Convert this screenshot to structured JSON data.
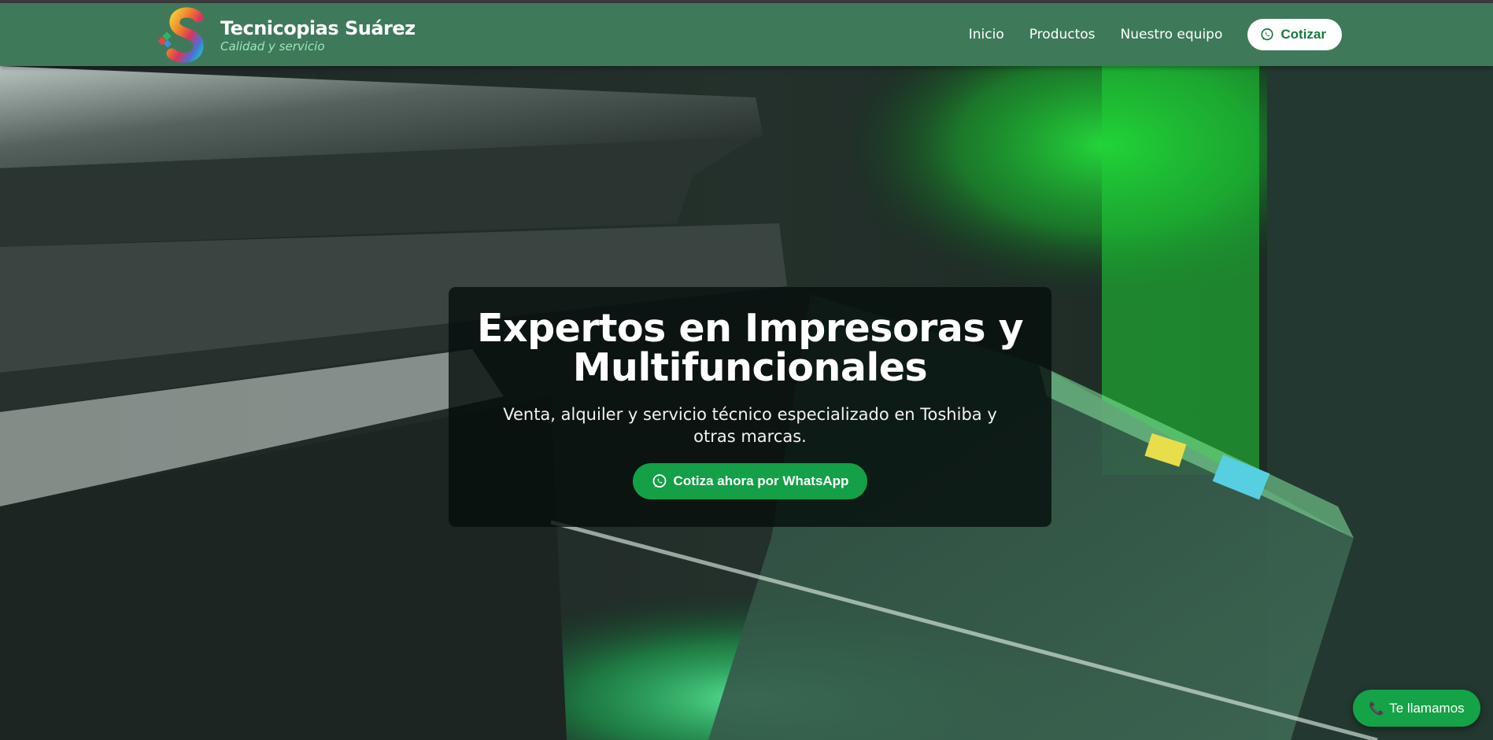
{
  "brand": {
    "name": "Tecnicopias Suárez",
    "tagline": "Calidad y servicio"
  },
  "nav": {
    "items": [
      {
        "label": "Inicio"
      },
      {
        "label": "Productos"
      },
      {
        "label": "Nuestro equipo"
      }
    ],
    "cta_label": "Cotizar"
  },
  "hero": {
    "title_line1": "Expertos en Impresoras y",
    "title_line2": "Multifuncionales",
    "subtitle": "Venta, alquiler y servicio técnico especializado en Toshiba y otras marcas.",
    "button_label": "Cotiza ahora por WhatsApp"
  },
  "floating_button": {
    "label": "Te llamamos",
    "icon": "phone-icon"
  },
  "colors": {
    "header_bg": "#3e7a5a",
    "accent_green": "#13a046",
    "cta_text": "#17793d"
  }
}
